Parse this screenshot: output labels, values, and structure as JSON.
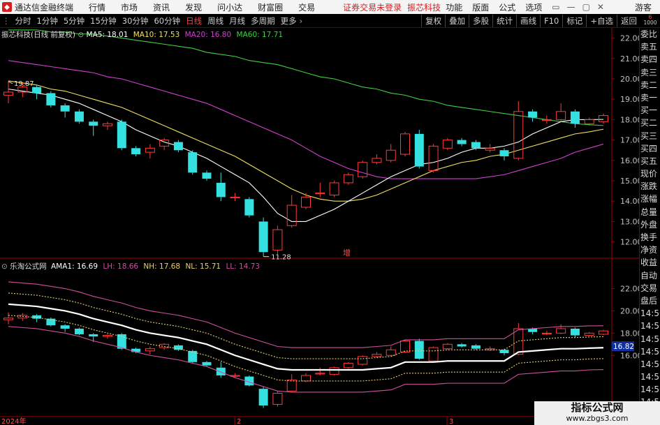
{
  "window": {
    "app_title": "通达信金融终端",
    "menu": [
      "行情",
      "市场",
      "资讯",
      "发现",
      "问小达",
      "财富圈",
      "交易"
    ],
    "notice": "证券交易未登录",
    "stock_tab": "振芯科技",
    "right_menu": [
      "功能",
      "版面",
      "公式",
      "选项"
    ],
    "user": "游客"
  },
  "toolbar": {
    "periods": [
      "分时",
      "1分钟",
      "5分钟",
      "15分钟",
      "30分钟",
      "60分钟",
      "日线",
      "周线",
      "月线",
      "多周期",
      "更多"
    ],
    "active_period": "日线",
    "right_buttons": [
      "复权",
      "叠加",
      "多股",
      "统计",
      "画线",
      "F10",
      "标记",
      "+自选",
      "返回"
    ],
    "corner_top": "6",
    "corner_bottom": "1000"
  },
  "main_legend": {
    "title": "振芯科技(日线 前复权)",
    "ma5": "MA5: 18.01",
    "ma10": "MA10: 17.53",
    "ma20": "MA20: 16.80",
    "ma60": "MA60: 17.71"
  },
  "sub_legend": {
    "title": "乐淘公式网",
    "ama1": "AMA1: 16.69",
    "lh": "LH: 18.66",
    "nh": "NH: 17.68",
    "nl": "NL: 15.71",
    "ll": "LL: 14.73"
  },
  "sidebar_items": [
    "委比",
    "卖五",
    "卖四",
    "卖三",
    "卖二",
    "卖一",
    "买一",
    "买二",
    "买三",
    "买四",
    "买五",
    "现价",
    "涨跌",
    "涨幅",
    "总量",
    "外盘",
    "换手",
    "净资",
    "收益",
    "自动",
    "交易",
    "盘后",
    "14:56",
    "14:56",
    "14:56",
    "14:56",
    "14:56",
    "14:56",
    "14:56",
    "14:56",
    "14:56"
  ],
  "markers": {
    "high_label": "19.87",
    "low_label": "11.28",
    "zeng": "增",
    "sub_value": "16.82"
  },
  "x_axis": {
    "year": "2024年",
    "m2": "2",
    "m3": "3"
  },
  "watermark": {
    "line1": "指标公式网",
    "line2": "www.zbgs3.com"
  },
  "chart_data": [
    {
      "type": "candlestick",
      "title": "振芯科技(日线 前复权)",
      "y_ticks": [
        12,
        13,
        14,
        15,
        16,
        17,
        18,
        19,
        20,
        21,
        22
      ],
      "ylim": [
        11.2,
        22.5
      ],
      "candles": [
        {
          "o": 19.2,
          "c": 19.35,
          "h": 19.87,
          "l": 18.8
        },
        {
          "o": 19.35,
          "c": 19.6,
          "h": 19.8,
          "l": 19.1
        },
        {
          "o": 19.6,
          "c": 19.3,
          "h": 19.7,
          "l": 19.0
        },
        {
          "o": 19.3,
          "c": 18.7,
          "h": 19.4,
          "l": 18.6
        },
        {
          "o": 18.7,
          "c": 18.4,
          "h": 18.8,
          "l": 18.1
        },
        {
          "o": 18.4,
          "c": 17.9,
          "h": 18.5,
          "l": 17.8
        },
        {
          "o": 17.9,
          "c": 17.7,
          "h": 18.0,
          "l": 17.2
        },
        {
          "o": 17.7,
          "c": 17.8,
          "h": 17.9,
          "l": 17.5
        },
        {
          "o": 17.9,
          "c": 16.6,
          "h": 18.0,
          "l": 16.5
        },
        {
          "o": 16.6,
          "c": 16.3,
          "h": 16.7,
          "l": 16.2
        },
        {
          "o": 16.4,
          "c": 16.6,
          "h": 16.8,
          "l": 16.1
        },
        {
          "o": 16.7,
          "c": 17.0,
          "h": 17.1,
          "l": 16.5
        },
        {
          "o": 16.9,
          "c": 16.5,
          "h": 17.0,
          "l": 16.4
        },
        {
          "o": 16.4,
          "c": 15.4,
          "h": 16.5,
          "l": 15.3
        },
        {
          "o": 15.4,
          "c": 15.1,
          "h": 15.5,
          "l": 15.0
        },
        {
          "o": 14.9,
          "c": 14.2,
          "h": 15.4,
          "l": 14.0
        },
        {
          "o": 14.2,
          "c": 14.2,
          "h": 14.4,
          "l": 14.0
        },
        {
          "o": 14.1,
          "c": 13.3,
          "h": 14.2,
          "l": 13.2
        },
        {
          "o": 13.0,
          "c": 11.5,
          "h": 13.2,
          "l": 11.28
        },
        {
          "o": 11.6,
          "c": 12.6,
          "h": 12.8,
          "l": 11.4
        },
        {
          "o": 12.8,
          "c": 13.8,
          "h": 14.3,
          "l": 12.7
        },
        {
          "o": 13.7,
          "c": 14.2,
          "h": 14.4,
          "l": 13.6
        },
        {
          "o": 14.4,
          "c": 14.4,
          "h": 14.9,
          "l": 14.2
        },
        {
          "o": 14.3,
          "c": 14.9,
          "h": 15.0,
          "l": 14.2
        },
        {
          "o": 14.9,
          "c": 15.3,
          "h": 15.4,
          "l": 14.8
        },
        {
          "o": 15.2,
          "c": 15.9,
          "h": 16.0,
          "l": 15.1
        },
        {
          "o": 15.9,
          "c": 16.1,
          "h": 16.3,
          "l": 15.8
        },
        {
          "o": 16.0,
          "c": 16.5,
          "h": 16.8,
          "l": 15.9
        },
        {
          "o": 16.3,
          "c": 17.3,
          "h": 17.4,
          "l": 16.2
        },
        {
          "o": 17.3,
          "c": 15.7,
          "h": 17.5,
          "l": 15.6
        },
        {
          "o": 15.5,
          "c": 16.7,
          "h": 16.8,
          "l": 15.4
        },
        {
          "o": 16.6,
          "c": 17.0,
          "h": 17.1,
          "l": 16.5
        },
        {
          "o": 17.0,
          "c": 16.8,
          "h": 17.1,
          "l": 16.7
        },
        {
          "o": 16.9,
          "c": 16.6,
          "h": 17.0,
          "l": 16.5
        },
        {
          "o": 16.5,
          "c": 16.6,
          "h": 16.8,
          "l": 16.4
        },
        {
          "o": 16.5,
          "c": 16.2,
          "h": 16.6,
          "l": 16.0
        },
        {
          "o": 16.1,
          "c": 18.4,
          "h": 18.9,
          "l": 16.0
        },
        {
          "o": 18.4,
          "c": 18.1,
          "h": 18.5,
          "l": 17.9
        },
        {
          "o": 18.0,
          "c": 18.0,
          "h": 18.2,
          "l": 17.8
        },
        {
          "o": 18.0,
          "c": 18.4,
          "h": 18.8,
          "l": 17.9
        },
        {
          "o": 18.4,
          "c": 17.8,
          "h": 18.5,
          "l": 17.6
        },
        {
          "o": 17.8,
          "c": 18.0,
          "h": 18.1,
          "l": 17.7
        },
        {
          "o": 17.9,
          "c": 18.2,
          "h": 18.3,
          "l": 17.8
        }
      ],
      "ma_series": [
        {
          "name": "MA5",
          "color": "#ffffff",
          "values": [
            19.5,
            19.4,
            19.3,
            19.2,
            19.0,
            18.8,
            18.5,
            18.2,
            17.9,
            17.5,
            17.2,
            16.9,
            16.7,
            16.4,
            16.1,
            15.7,
            15.3,
            14.9,
            14.2,
            13.4,
            13.0,
            13.0,
            13.3,
            13.6,
            14.0,
            14.4,
            14.8,
            15.2,
            15.5,
            15.8,
            15.9,
            16.1,
            16.4,
            16.6,
            16.6,
            16.7,
            16.9,
            17.3,
            17.6,
            17.9,
            18.0,
            18.0,
            18.01
          ]
        },
        {
          "name": "MA10",
          "color": "#f0e060",
          "values": [
            19.9,
            19.8,
            19.7,
            19.5,
            19.4,
            19.2,
            19.0,
            18.8,
            18.6,
            18.3,
            18.0,
            17.7,
            17.4,
            17.1,
            16.8,
            16.5,
            16.2,
            15.8,
            15.4,
            15.0,
            14.6,
            14.3,
            14.1,
            14.0,
            14.0,
            14.1,
            14.3,
            14.6,
            14.9,
            15.2,
            15.5,
            15.7,
            15.9,
            16.0,
            16.2,
            16.3,
            16.5,
            16.7,
            16.9,
            17.1,
            17.3,
            17.4,
            17.53
          ]
        },
        {
          "name": "MA20",
          "color": "#d040d0",
          "values": [
            20.9,
            20.8,
            20.7,
            20.6,
            20.5,
            20.4,
            20.3,
            20.1,
            20.0,
            19.8,
            19.6,
            19.4,
            19.2,
            19.0,
            18.8,
            18.5,
            18.2,
            17.9,
            17.6,
            17.3,
            17.0,
            16.6,
            16.2,
            15.9,
            15.6,
            15.4,
            15.2,
            15.1,
            15.1,
            15.1,
            15.1,
            15.1,
            15.1,
            15.1,
            15.2,
            15.3,
            15.5,
            15.7,
            15.9,
            16.1,
            16.4,
            16.6,
            16.8
          ]
        },
        {
          "name": "MA60",
          "color": "#40d040",
          "values": [
            22.4,
            22.4,
            22.4,
            22.3,
            22.3,
            22.2,
            22.2,
            22.1,
            22.0,
            21.9,
            21.8,
            21.7,
            21.6,
            21.5,
            21.3,
            21.2,
            21.1,
            20.9,
            20.8,
            20.7,
            20.5,
            20.3,
            20.1,
            20.0,
            19.8,
            19.6,
            19.5,
            19.3,
            19.2,
            19.0,
            18.9,
            18.7,
            18.6,
            18.5,
            18.4,
            18.3,
            18.2,
            18.1,
            18.0,
            17.9,
            17.8,
            17.75,
            17.71
          ]
        }
      ]
    },
    {
      "type": "line",
      "title": "乐淘公式网",
      "y_ticks": [
        16,
        18,
        20,
        22
      ],
      "ylim": [
        10.5,
        23.6
      ],
      "series": [
        {
          "name": "LH",
          "color": "#d050a0",
          "values": [
            22.6,
            22.5,
            22.4,
            22.2,
            22.0,
            21.7,
            21.3,
            21.0,
            20.7,
            20.3,
            20.0,
            19.8,
            19.6,
            19.3,
            19.0,
            18.5,
            18.0,
            17.6,
            17.2,
            16.8,
            16.7,
            16.7,
            16.7,
            16.7,
            16.7,
            16.7,
            16.8,
            16.9,
            17.4,
            17.4,
            17.4,
            17.5,
            17.5,
            17.5,
            17.5,
            17.5,
            18.3,
            18.4,
            18.5,
            18.6,
            18.6,
            18.65,
            18.66
          ]
        },
        {
          "name": "NH",
          "color": "#e8d070",
          "values": [
            21.6,
            21.5,
            21.4,
            21.2,
            21.0,
            20.7,
            20.3,
            20.0,
            19.7,
            19.3,
            19.0,
            18.8,
            18.6,
            18.3,
            18.0,
            17.5,
            17.0,
            16.6,
            16.2,
            15.8,
            15.7,
            15.7,
            15.7,
            15.7,
            15.7,
            15.7,
            15.8,
            15.9,
            16.4,
            16.4,
            16.4,
            16.5,
            16.5,
            16.5,
            16.5,
            16.5,
            17.3,
            17.4,
            17.5,
            17.6,
            17.6,
            17.65,
            17.68
          ]
        },
        {
          "name": "AMA1",
          "color": "#ffffff",
          "values": [
            20.6,
            20.5,
            20.4,
            20.2,
            20.0,
            19.7,
            19.3,
            19.0,
            18.7,
            18.3,
            18.0,
            17.8,
            17.6,
            17.3,
            17.0,
            16.5,
            16.0,
            15.6,
            15.2,
            14.8,
            14.7,
            14.7,
            14.7,
            14.7,
            14.7,
            14.7,
            14.8,
            14.9,
            15.4,
            15.4,
            15.4,
            15.5,
            15.5,
            15.5,
            15.5,
            15.5,
            16.3,
            16.4,
            16.5,
            16.6,
            16.6,
            16.65,
            16.69
          ]
        },
        {
          "name": "NL",
          "color": "#e8d070",
          "values": [
            19.6,
            19.5,
            19.4,
            19.2,
            19.0,
            18.7,
            18.3,
            18.0,
            17.7,
            17.3,
            17.0,
            16.8,
            16.6,
            16.3,
            16.0,
            15.5,
            15.0,
            14.6,
            14.2,
            13.8,
            13.7,
            13.7,
            13.7,
            13.7,
            13.7,
            13.7,
            13.8,
            13.9,
            14.4,
            14.4,
            14.4,
            14.5,
            14.5,
            14.5,
            14.5,
            14.5,
            15.3,
            15.4,
            15.5,
            15.6,
            15.6,
            15.68,
            15.71
          ]
        },
        {
          "name": "LL",
          "color": "#d050a0",
          "values": [
            18.6,
            18.5,
            18.4,
            18.2,
            18.0,
            17.7,
            17.3,
            17.0,
            16.7,
            16.3,
            16.0,
            15.8,
            15.6,
            15.3,
            15.0,
            14.5,
            14.0,
            13.6,
            13.2,
            12.8,
            12.7,
            12.7,
            12.7,
            12.7,
            12.7,
            12.7,
            12.8,
            12.9,
            13.4,
            13.4,
            13.4,
            13.5,
            13.5,
            13.5,
            13.5,
            13.5,
            14.3,
            14.4,
            14.5,
            14.6,
            14.6,
            14.7,
            14.73
          ]
        }
      ]
    }
  ],
  "colors": {
    "up": "#ff3a3a",
    "down": "#35e0e0",
    "axis": "#a00000",
    "tick": "#c0c0c0"
  }
}
